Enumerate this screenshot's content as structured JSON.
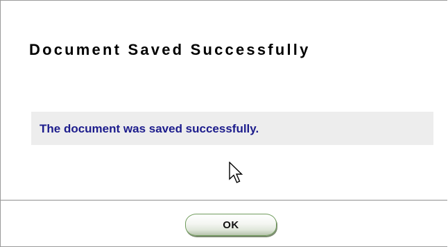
{
  "dialog": {
    "title": "Document Saved Successfully",
    "message": "The document was saved successfully.",
    "ok_label": "OK"
  },
  "icons": {
    "cursor": "mouse-pointer-icon"
  },
  "colors": {
    "message_text": "#1c1c8c",
    "message_background": "#ededed",
    "title_text": "#000000",
    "border": "#9a9a9a"
  }
}
